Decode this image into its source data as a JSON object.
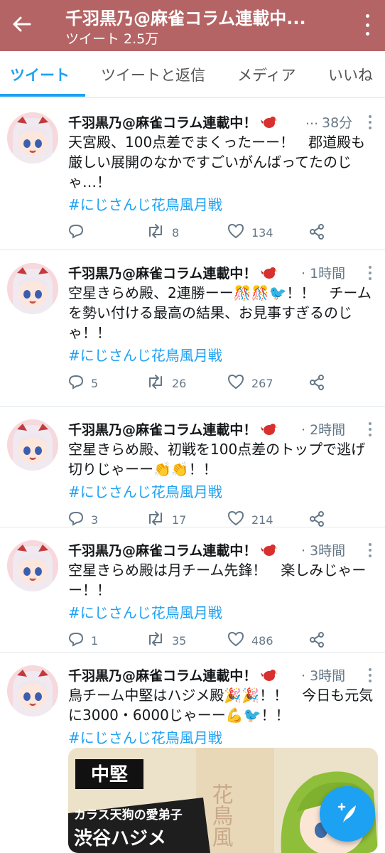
{
  "header": {
    "title": "千羽黒乃@麻雀コラム連載中...",
    "subtitle": "ツイート 2.5万"
  },
  "tabs": [
    {
      "label": "ツイート",
      "active": true
    },
    {
      "label": "ツイートと返信",
      "active": false
    },
    {
      "label": "メディア",
      "active": false
    },
    {
      "label": "いいね",
      "active": false
    }
  ],
  "tweets": [
    {
      "author": "千羽黒乃@麻雀コラム連載中！",
      "ellipsis": "...",
      "time": "38分",
      "text": "天宮殿、100点差でまくったーー！　郡道殿も厳しい展開のなかですごいがんばってたのじゃ…！",
      "hashtag": "#にじさんじ花鳥風月戦",
      "replies": "",
      "retweets": "8",
      "likes": "134"
    },
    {
      "author": "千羽黒乃@麻雀コラム連載中！",
      "time": "· 1時間",
      "text": "空星きらめ殿、2連勝ーー🎊🎊🐦！！　チームを勢い付ける最高の結果、お見事すぎるのじゃ！！",
      "hashtag": "#にじさんじ花鳥風月戦",
      "replies": "5",
      "retweets": "26",
      "likes": "267"
    },
    {
      "author": "千羽黒乃@麻雀コラム連載中！",
      "time": "· 2時間",
      "text": "空星きらめ殿、初戦を100点差のトップで逃げ切りじゃーー👏👏！！",
      "hashtag": "#にじさんじ花鳥風月戦",
      "replies": "3",
      "retweets": "17",
      "likes": "214"
    },
    {
      "author": "千羽黒乃@麻雀コラム連載中！",
      "time": "· 3時間",
      "text": "空星きらめ殿は月チーム先鋒！　楽しみじゃーー！！",
      "hashtag": "#にじさんじ花鳥風月戦",
      "replies": "1",
      "retweets": "35",
      "likes": "486"
    },
    {
      "author": "千羽黒乃@麻雀コラム連載中！",
      "time": "· 3時間",
      "text": "鳥チーム中堅はハジメ殿🎉🎉！！　今日も元気に3000・6000じゃーー💪🐦！！",
      "hashtag": "#にじさんじ花鳥風月戦"
    }
  ],
  "media": {
    "badge": "中堅",
    "caption": "カラス天狗の愛弟子",
    "name": "渋谷ハジメ",
    "side_text": "花鳥風"
  },
  "colors": {
    "header": "#b56465",
    "accent": "#1da1f2",
    "muted": "#657786"
  }
}
